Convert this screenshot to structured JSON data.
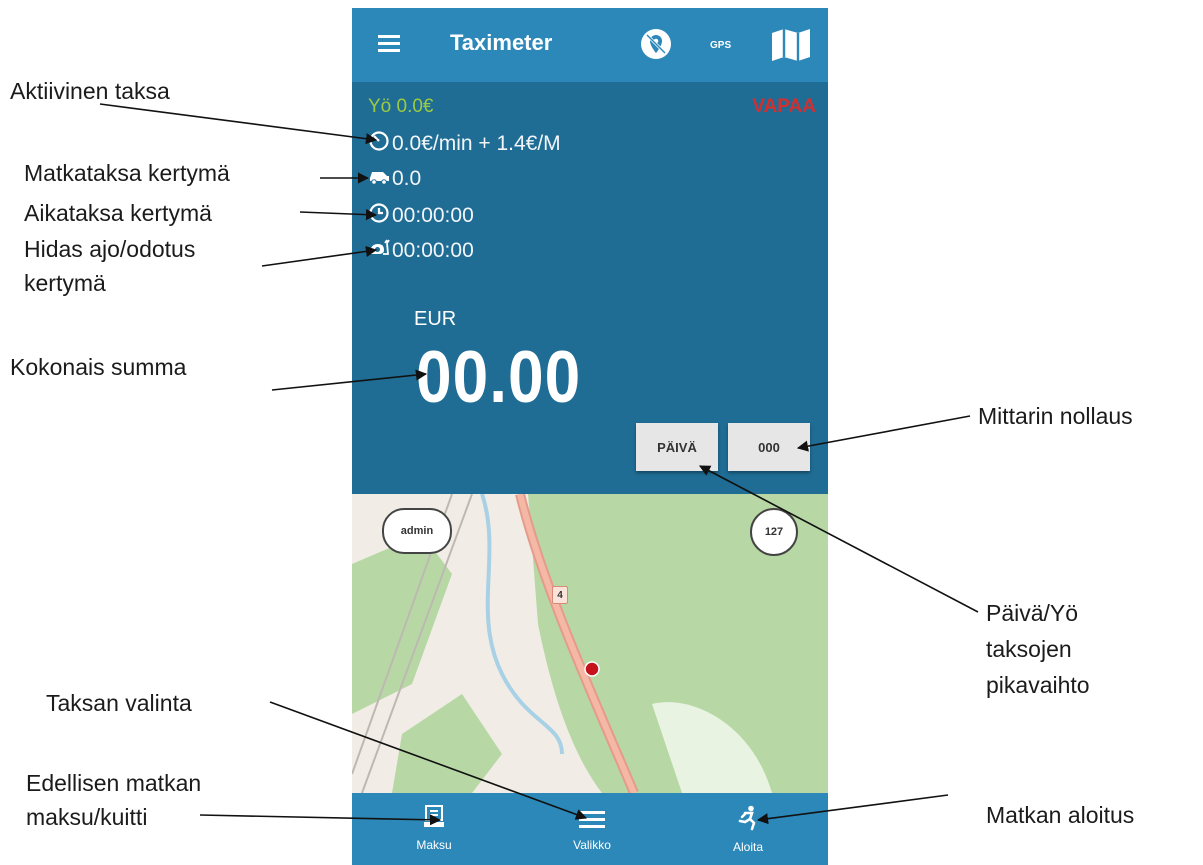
{
  "app": {
    "title": "Taximeter",
    "gps_label": "GPS",
    "tariff_name": "Yö 0.0€",
    "status": "VAPAA",
    "rate": "0.0€/min + 1.4€/M",
    "distance_total": "0.0",
    "time_total": "00:00:00",
    "slow_total": "00:00:00",
    "currency": "EUR",
    "total": "00.00",
    "day_night_button": "PÄIVÄ",
    "reset_button": "000"
  },
  "map": {
    "user_badge": "admin",
    "count_badge": "127",
    "road_label": "4"
  },
  "nav": {
    "pay_label": "Maksu",
    "menu_label": "Valikko",
    "start_label": "Aloita"
  },
  "annotations": {
    "active_tariff": "Aktiivinen taksa",
    "distance_accum": "Matkataksa kertymä",
    "time_accum": "Aikataksa kertymä",
    "slow_accum_1": "Hidas ajo/odotus",
    "slow_accum_2": "kertymä",
    "total_sum": "Kokonais summa",
    "meter_reset": "Mittarin nollaus",
    "day_night_1": "Päivä/Yö",
    "day_night_2": "taksojen",
    "day_night_3": "pikavaihto",
    "tariff_select": "Taksan valinta",
    "prev_payment_1": "Edellisen matkan",
    "prev_payment_2": "maksu/kuitti",
    "trip_start": "Matkan aloitus"
  },
  "colors": {
    "topbar": "#2c88b9",
    "meter_bg": "#1f6c95",
    "tariff_green": "#9ccb3f",
    "status_red": "#d22f2f"
  }
}
